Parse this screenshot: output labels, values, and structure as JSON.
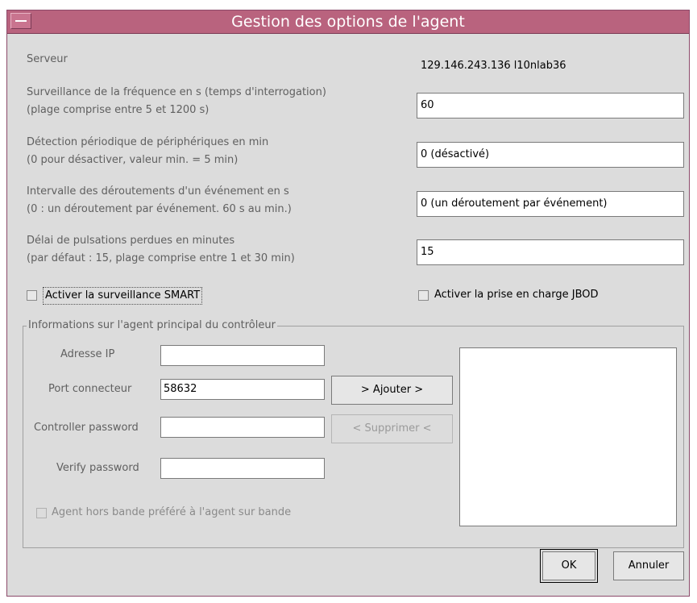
{
  "window": {
    "title": "Gestion des options de l'agent"
  },
  "server": {
    "label": "Serveur",
    "value": "129.146.243.136 l10nlab36"
  },
  "poll": {
    "label_line1": "Surveillance de la fréquence en s (temps d'interrogation)",
    "label_line2": "(plage comprise entre 5 et 1200 s)",
    "value": "60"
  },
  "discovery": {
    "label_line1": "Détection périodique de périphériques en min",
    "label_line2": "(0 pour désactiver, valeur min. = 5 min)",
    "value": "0 (désactivé)"
  },
  "trap": {
    "label_line1": "Intervalle des déroutements d'un événement en s",
    "label_line2": "(0 : un déroutement par événement. 60 s au min.)",
    "value": "0 (un déroutement par événement)"
  },
  "heartbeat": {
    "label_line1": "Délai de pulsations perdues en minutes",
    "label_line2": "(par défaut : 15, plage comprise entre 1 et 30 min)",
    "value": "15"
  },
  "options": {
    "smart_label": "Activer la surveillance SMART",
    "smart_checked": false,
    "jbod_label": "Activer la prise en charge JBOD",
    "jbod_checked": false
  },
  "controller": {
    "group_title": "Informations sur l'agent principal du contrôleur",
    "ip_label": "Adresse IP",
    "ip_value": "",
    "port_label": "Port connecteur",
    "port_value": "58632",
    "password_label": "Controller password",
    "password_value": "",
    "verify_label": "Verify password",
    "verify_value": "",
    "add_button": "> Ajouter >",
    "remove_button": "< Supprimer <",
    "outofband_label": "Agent hors bande préféré à l'agent sur bande",
    "outofband_checked": false
  },
  "buttons": {
    "ok": "OK",
    "cancel": "Annuler"
  },
  "colors": {
    "titlebar": "#b9637e",
    "window_bg": "#dcdcdc"
  }
}
